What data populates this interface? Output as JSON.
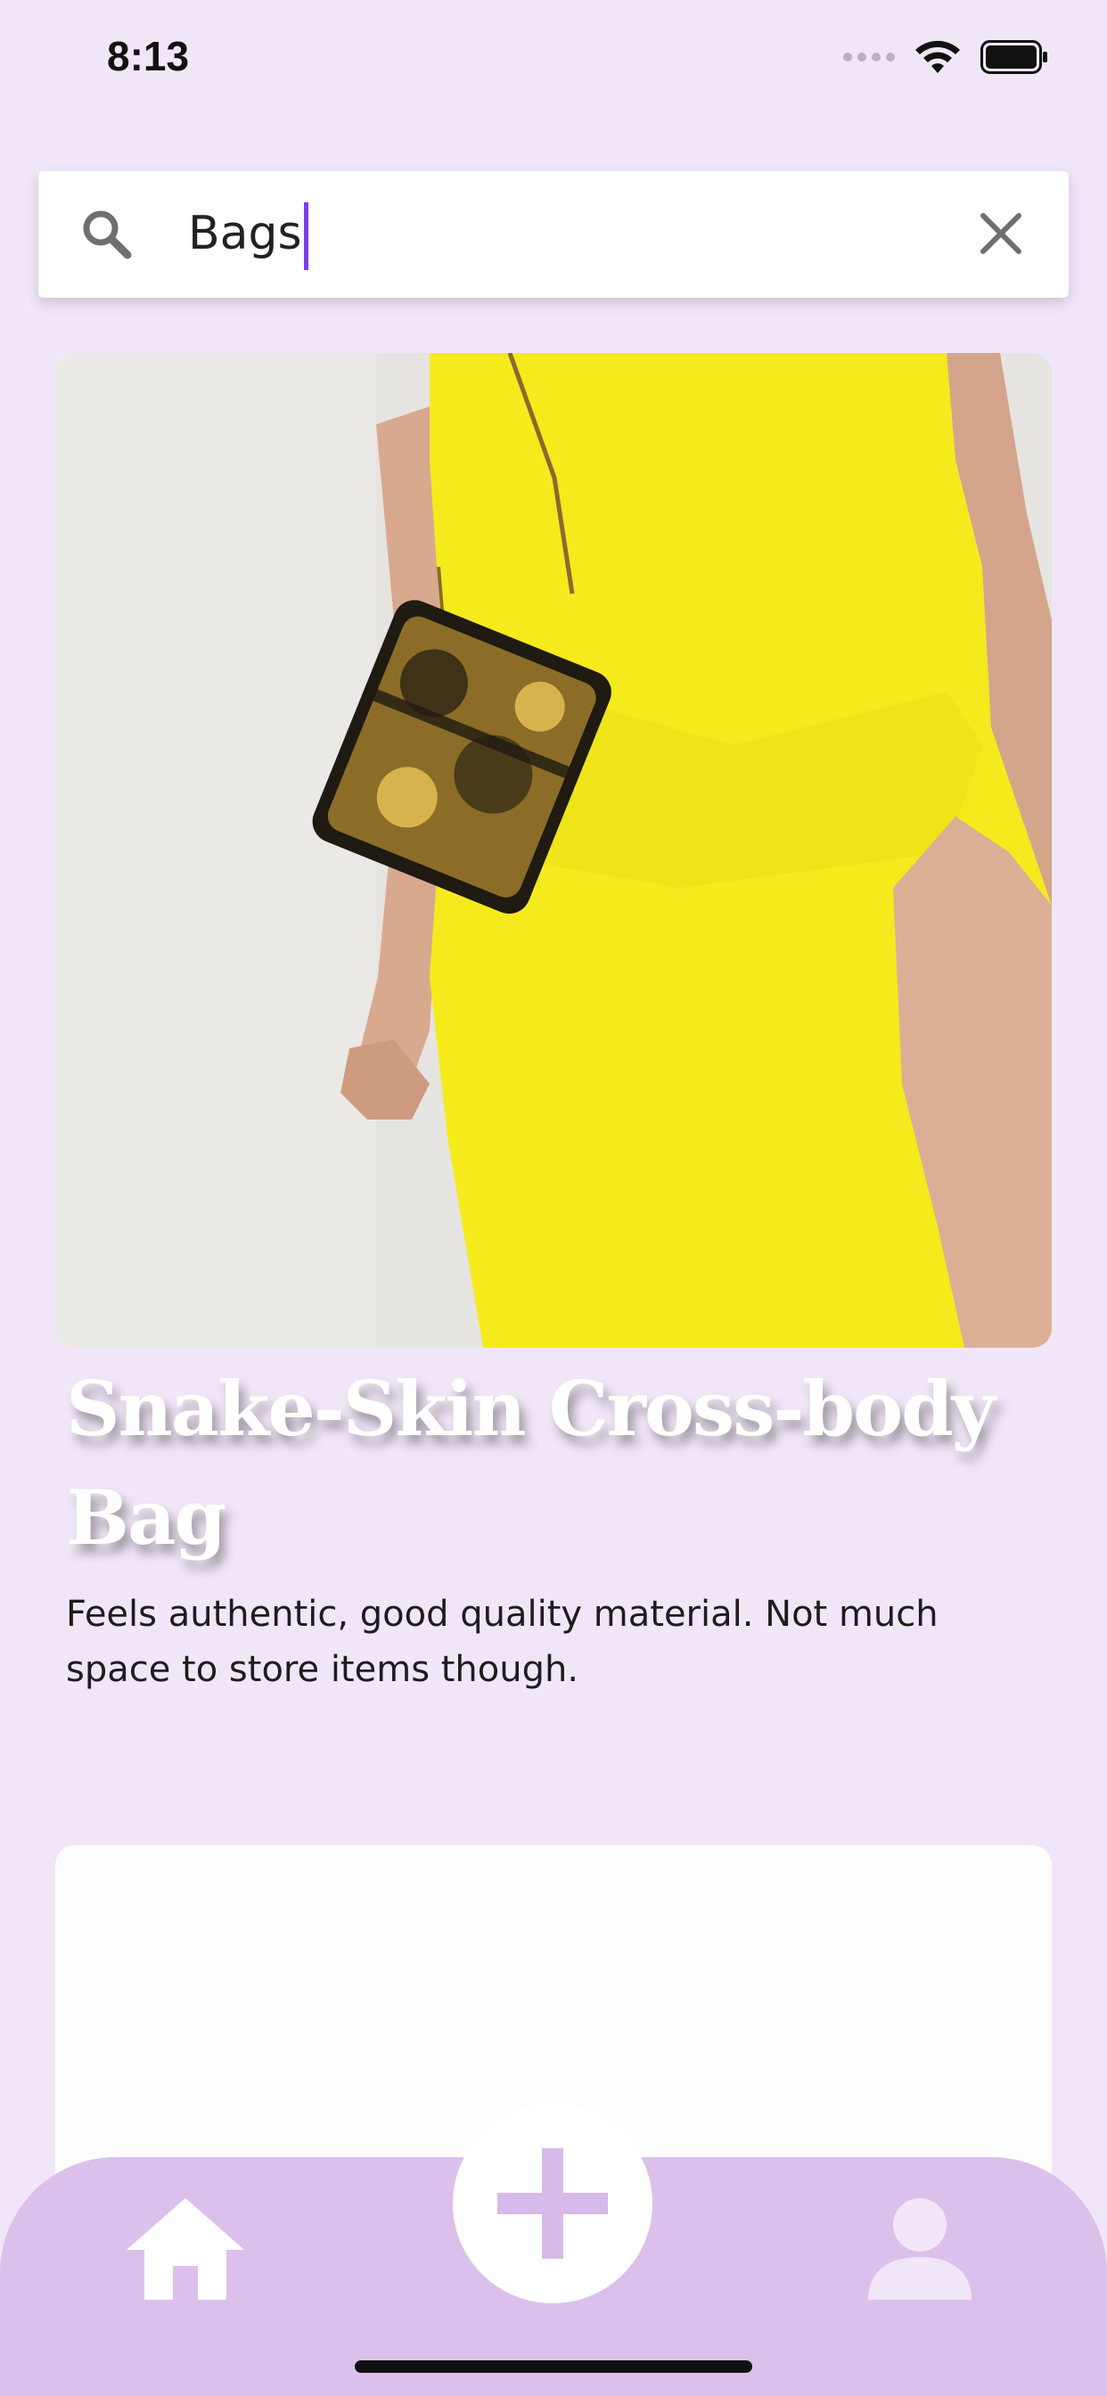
{
  "status_bar": {
    "time": "8:13",
    "icons": [
      "signal-icon",
      "wifi-icon",
      "battery-icon"
    ]
  },
  "search": {
    "value": "Bags",
    "icon": "search-icon",
    "clear_icon": "close-icon"
  },
  "results": [
    {
      "title": "Snake-Skin Cross-body Bag",
      "description": "Feels authentic, good quality material. Not much space to store items though.",
      "image": "product-photo-yellow-dress-bag"
    },
    {
      "title": "",
      "description": "",
      "image": "blank-card"
    }
  ],
  "tab_bar": {
    "items": [
      {
        "icon": "home-icon"
      },
      {
        "icon": "plus-icon"
      },
      {
        "icon": "profile-icon"
      }
    ]
  },
  "colors": {
    "background": "#f1e6f8",
    "tab_bar": "#dbc0ec",
    "caret": "#7a3df0",
    "icon_gray": "#6f6f6f"
  }
}
